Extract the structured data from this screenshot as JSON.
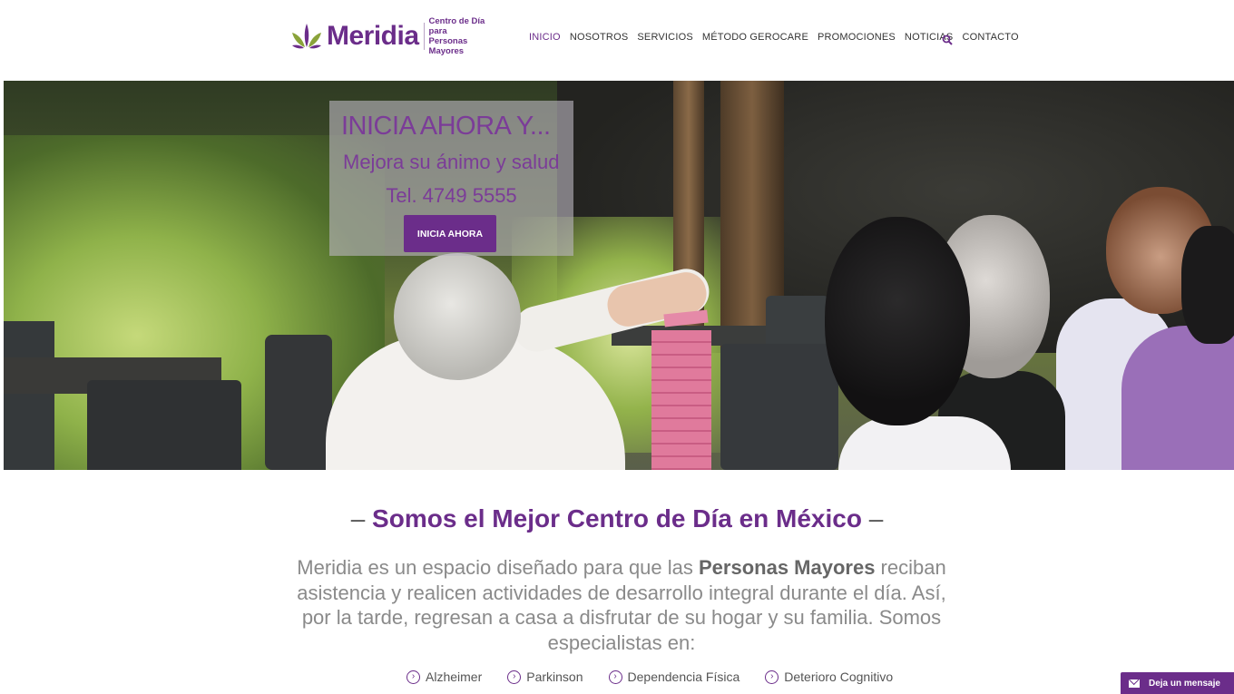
{
  "header": {
    "logo": {
      "word": "Meridia",
      "tagline_line1": "Centro de Día para",
      "tagline_line2": "Personas Mayores"
    },
    "nav": [
      {
        "label": "INICIO",
        "active": true
      },
      {
        "label": "NOSOTROS",
        "active": false
      },
      {
        "label": "SERVICIOS",
        "active": false
      },
      {
        "label": "MÉTODO GEROCARE",
        "active": false
      },
      {
        "label": "PROMOCIONES",
        "active": false
      },
      {
        "label": "NOTICIAS",
        "active": false
      },
      {
        "label": "CONTACTO",
        "active": false
      }
    ],
    "search_icon": "search-icon"
  },
  "hero": {
    "title": "INICIA AHORA Y...",
    "subtitle": "Mejora su ánimo y salud",
    "phone": "Tel. 4749 5555",
    "button": "INICIA AHORA"
  },
  "intro": {
    "dash_left": "–",
    "title": "Somos el Mejor Centro de Día en México",
    "dash_right": "–",
    "text_before": "Meridia es un espacio diseñado para que las ",
    "text_bold": "Personas Mayores",
    "text_after": " reciban asistencia y realicen actividades de desarrollo integral durante el día. Así, por la tarde, regresan a casa a disfrutar de su hogar y su familia. Somos especialistas en:"
  },
  "specialties": [
    {
      "label": "Alzheimer"
    },
    {
      "label": "Parkinson"
    },
    {
      "label": "Dependencia Física"
    },
    {
      "label": "Deterioro Cognitivo"
    }
  ],
  "chat": {
    "label": "Deja un mensaje",
    "icon": "envelope-icon"
  },
  "colors": {
    "brand_purple": "#6b2d8a",
    "logo_green": "#8aa33a",
    "text_gray": "#8a8a8a"
  }
}
